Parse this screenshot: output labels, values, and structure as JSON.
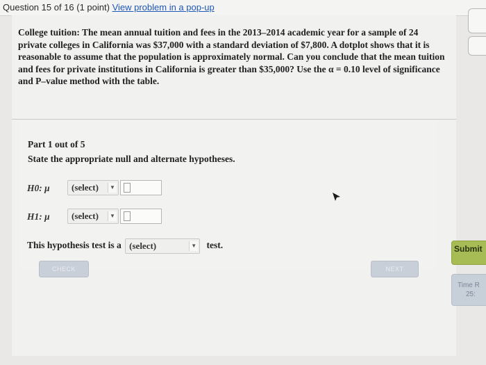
{
  "header": {
    "question_counter": "Question 15 of 16 (1 point)",
    "popup_link": "View problem in a pop-up"
  },
  "question": {
    "prefix_bold": "College tuition:",
    "text": "The mean annual tuition and fees in the 2013–2014 academic year for a sample of 24 private colleges in California was $37,000 with a standard deviation of $7,800. A dotplot shows that it is reasonable to assume that the population is approximately normal. Can you conclude that the mean tuition and fees for private institutions in California is greater than $35,000? Use the α = 0.10 level of significance and P–value method with the table."
  },
  "part": {
    "title": "Part 1 out of 5",
    "instruction": "State the appropriate null and alternate hypotheses."
  },
  "hypotheses": {
    "h0_label": "H0: μ",
    "h0_select": "(select)",
    "h0_value": "",
    "h1_label": "H1: μ",
    "h1_select": "(select)",
    "h1_value": ""
  },
  "test_type": {
    "prefix": "This hypothesis test is a",
    "select": "(select)",
    "suffix": "test."
  },
  "buttons": {
    "check": "CHECK",
    "next": "NEXT",
    "submit": "Submit"
  },
  "timer": {
    "label": "Time R",
    "value": "25:"
  },
  "colors": {
    "link": "#1f57b5",
    "submit": "#a8bc55",
    "disabled_button": "#c9cfd9"
  }
}
